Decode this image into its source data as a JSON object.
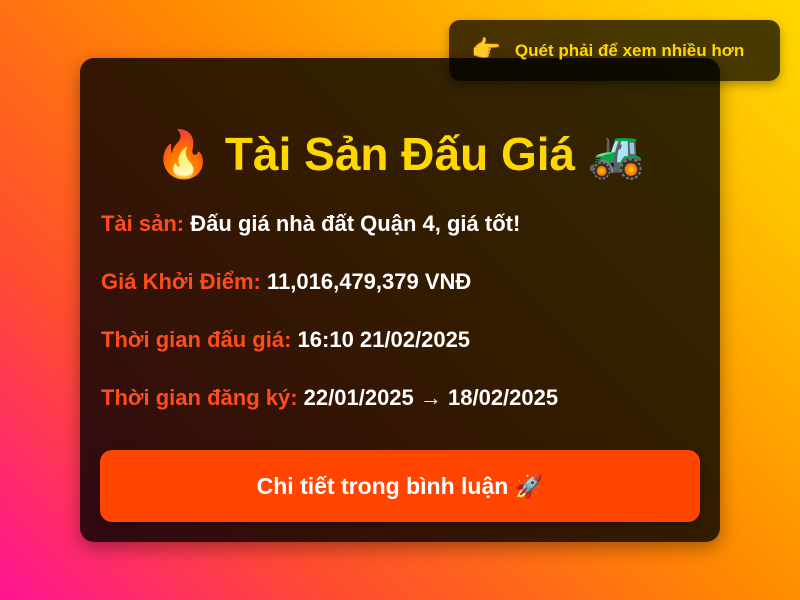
{
  "hint": {
    "icon": "👉",
    "text": "Quét phải để xem nhiều hơn"
  },
  "card": {
    "title_icon_left": "🔥",
    "title": "Tài Sản Đấu Giá",
    "title_icon_right": "🚜",
    "asset": {
      "label": "Tài sản:",
      "value": "Đấu giá nhà đất Quận 4, giá tốt!"
    },
    "starting_price": {
      "label": "Giá Khởi Điểm:",
      "value": "11,016,479,379 VNĐ"
    },
    "auction_time": {
      "label": "Thời gian đấu giá:",
      "value": "16:10 21/02/2025"
    },
    "registration_time": {
      "label": "Thời gian đăng ký:",
      "value": "22/01/2025 → 18/02/2025"
    },
    "cta": {
      "label": "Chi tiết trong bình luận",
      "icon": "🚀"
    }
  }
}
